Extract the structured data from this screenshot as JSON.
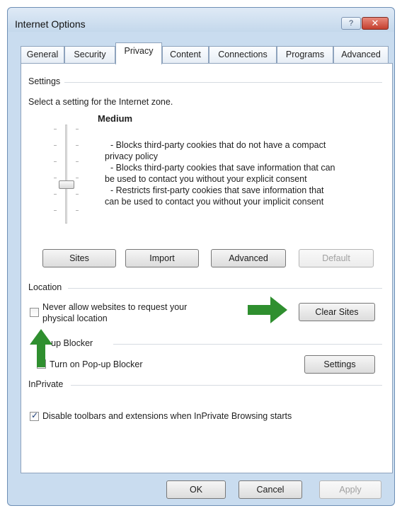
{
  "window": {
    "title": "Internet Options",
    "help_glyph": "?",
    "close_glyph": "✕"
  },
  "tabs": [
    {
      "label": "General",
      "active": false
    },
    {
      "label": "Security",
      "active": false
    },
    {
      "label": "Privacy",
      "active": true
    },
    {
      "label": "Content",
      "active": false
    },
    {
      "label": "Connections",
      "active": false
    },
    {
      "label": "Programs",
      "active": false
    },
    {
      "label": "Advanced",
      "active": false
    }
  ],
  "settings": {
    "group_label": "Settings",
    "instruction": "Select a setting for the Internet zone.",
    "level": "Medium",
    "description": [
      "- Blocks third-party cookies that do not have a compact",
      "privacy policy",
      "- Blocks third-party cookies that save information that can",
      "be used to contact you without your explicit consent",
      "- Restricts first-party cookies that save information that",
      "can be used to contact you without your implicit consent"
    ],
    "buttons": {
      "sites": "Sites",
      "import": "Import",
      "advanced": "Advanced",
      "default": "Default"
    }
  },
  "location": {
    "group_label": "Location",
    "never_allow_line1": "Never allow websites to request your",
    "never_allow_line2": "physical location",
    "never_allow_checked": false,
    "clear_sites": "Clear Sites"
  },
  "popup_blocker": {
    "group_label": "-up Blocker",
    "turn_on": "Turn on Pop-up Blocker",
    "settings": "Settings"
  },
  "inprivate": {
    "group_label": "InPrivate",
    "disable_toolbars": "Disable toolbars and extensions when InPrivate Browsing starts",
    "disable_toolbars_checked": true
  },
  "footer": {
    "ok": "OK",
    "cancel": "Cancel",
    "apply": "Apply"
  },
  "colors": {
    "arrow": "#2f8f2f",
    "titlebar": "#c9dcef",
    "close": "#c4402f"
  },
  "icons": [
    "help-icon",
    "close-icon",
    "green-arrow-right-icon",
    "green-arrow-up-icon"
  ]
}
